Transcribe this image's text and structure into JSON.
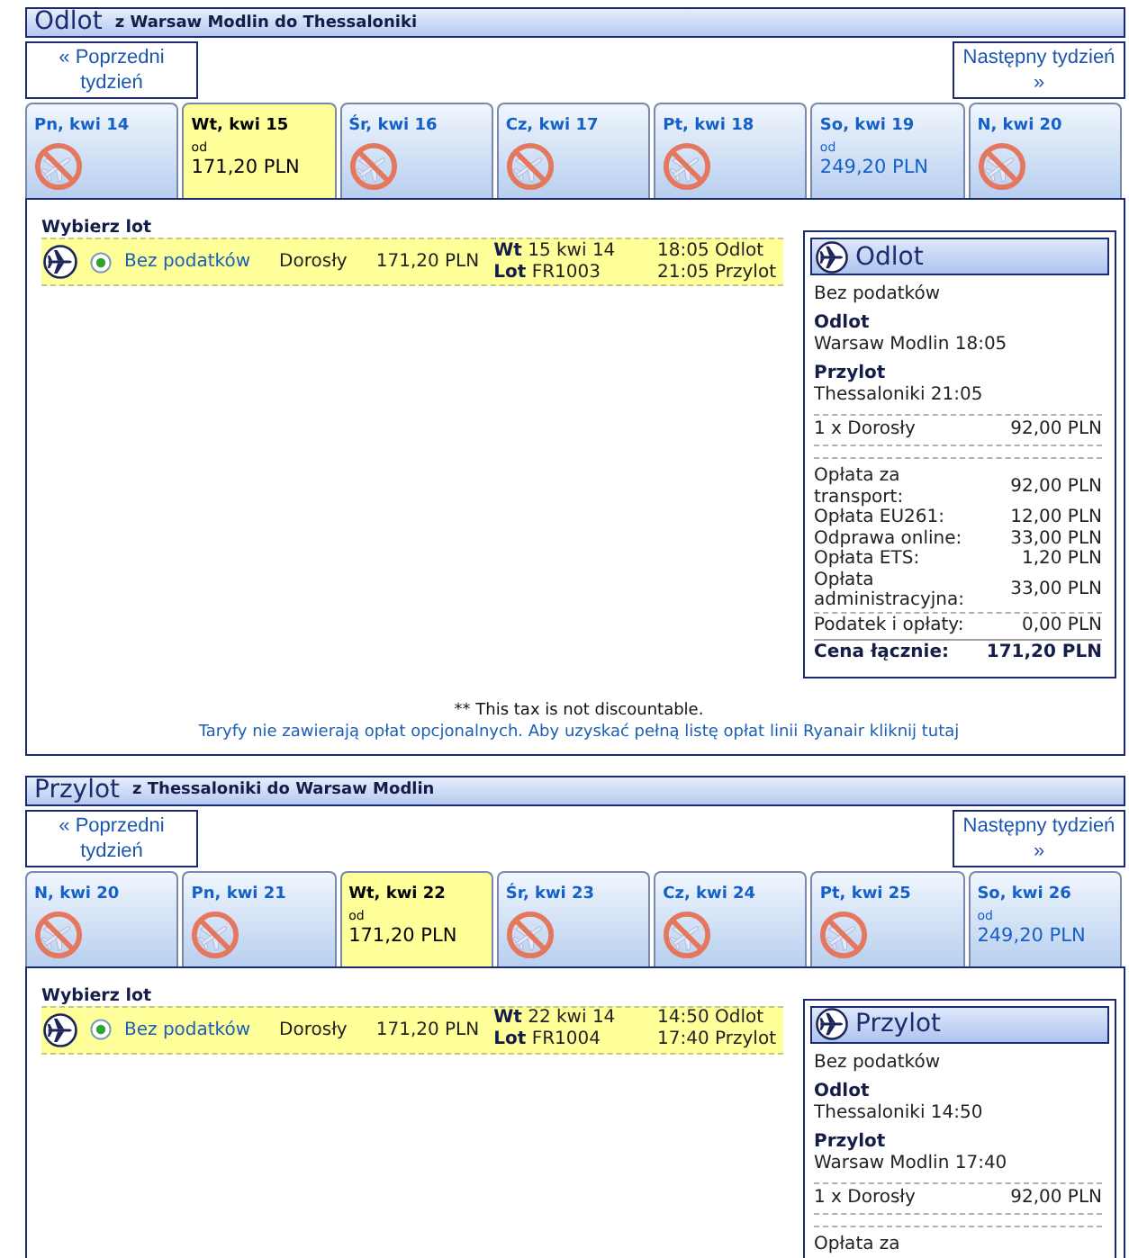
{
  "sections": [
    {
      "title": "Odlot",
      "route": "z Warsaw Modlin do Thessaloniki",
      "prev_week": "« Poprzedni tydzień",
      "next_week": "Następny tydzień »",
      "days": [
        {
          "label": "Pn, kwi 14",
          "kind": "unavailable",
          "selected": false
        },
        {
          "label": "Wt, kwi 15",
          "kind": "fare",
          "from": "od",
          "price": "171,20 PLN",
          "selected": true
        },
        {
          "label": "Śr, kwi 16",
          "kind": "unavailable",
          "selected": false
        },
        {
          "label": "Cz, kwi 17",
          "kind": "unavailable",
          "selected": false
        },
        {
          "label": "Pt, kwi 18",
          "kind": "unavailable",
          "selected": false
        },
        {
          "label": "So, kwi 19",
          "kind": "fare",
          "from": "od",
          "price": "249,20 PLN",
          "selected": false
        },
        {
          "label": "N, kwi 20",
          "kind": "unavailable",
          "selected": false
        }
      ],
      "heading": "Wybierz lot",
      "flight": {
        "selected": true,
        "fare": "Bez podatków",
        "passenger": "Dorosły",
        "price": "171,20 PLN",
        "date": "**Wt** 15 kwi 14",
        "number": "**Lot** FR1003",
        "departure": "18:05 Odlot",
        "arrival": "21:05 Przylot"
      },
      "summary": {
        "title": "Odlot",
        "fare": "Bez podatków",
        "departure_label": "Odlot",
        "departure": "Warsaw Modlin 18:05",
        "arrival_label": "Przylot",
        "arrival": "Thessaloniki 21:05",
        "passengers": [
          {
            "label": "1 x Dorosły",
            "amount": "92,00 PLN"
          }
        ],
        "fees": [
          {
            "label": "Opłata za transport:",
            "amount": "92,00 PLN"
          },
          {
            "label": "Opłata EU261:",
            "amount": "12,00 PLN"
          },
          {
            "label": "Odprawa online:",
            "amount": "33,00 PLN"
          },
          {
            "label": "Opłata ETS:",
            "amount": "1,20 PLN"
          },
          {
            "label": "Opłata administracyjna:",
            "amount": "33,00 PLN"
          }
        ],
        "taxes": {
          "label": "Podatek i opłaty:",
          "amount": "0,00 PLN"
        },
        "total": {
          "label": "Cena łącznie:",
          "amount": "171,20 PLN"
        }
      },
      "footnote": "** This tax is not discountable.",
      "link": "Taryfy nie zawierają opłat opcjonalnych. Aby uzyskać pełną listę opłat linii Ryanair kliknij tutaj"
    },
    {
      "title": "Przylot",
      "route": "z Thessaloniki do Warsaw Modlin",
      "prev_week": "« Poprzedni tydzień",
      "next_week": "Następny tydzień »",
      "days": [
        {
          "label": "N, kwi 20",
          "kind": "unavailable",
          "selected": false
        },
        {
          "label": "Pn, kwi 21",
          "kind": "unavailable",
          "selected": false
        },
        {
          "label": "Wt, kwi 22",
          "kind": "fare",
          "from": "od",
          "price": "171,20 PLN",
          "selected": true
        },
        {
          "label": "Śr, kwi 23",
          "kind": "unavailable",
          "selected": false
        },
        {
          "label": "Cz, kwi 24",
          "kind": "unavailable",
          "selected": false
        },
        {
          "label": "Pt, kwi 25",
          "kind": "unavailable",
          "selected": false
        },
        {
          "label": "So, kwi 26",
          "kind": "fare",
          "from": "od",
          "price": "249,20 PLN",
          "selected": false
        }
      ],
      "heading": "Wybierz lot",
      "flight": {
        "selected": true,
        "fare": "Bez podatków",
        "passenger": "Dorosły",
        "price": "171,20 PLN",
        "date": "**Wt** 22 kwi 14",
        "number": "**Lot** FR1004",
        "departure": "14:50 Odlot",
        "arrival": "17:40 Przylot"
      },
      "summary": {
        "title": "Przylot",
        "fare": "Bez podatków",
        "departure_label": "Odlot",
        "departure": "Thessaloniki 14:50",
        "arrival_label": "Przylot",
        "arrival": "Warsaw Modlin 17:40",
        "passengers": [
          {
            "label": "1 x Dorosły",
            "amount": "92,00 PLN"
          }
        ],
        "fees": [
          {
            "label": "Opłata za"
          }
        ]
      }
    }
  ]
}
